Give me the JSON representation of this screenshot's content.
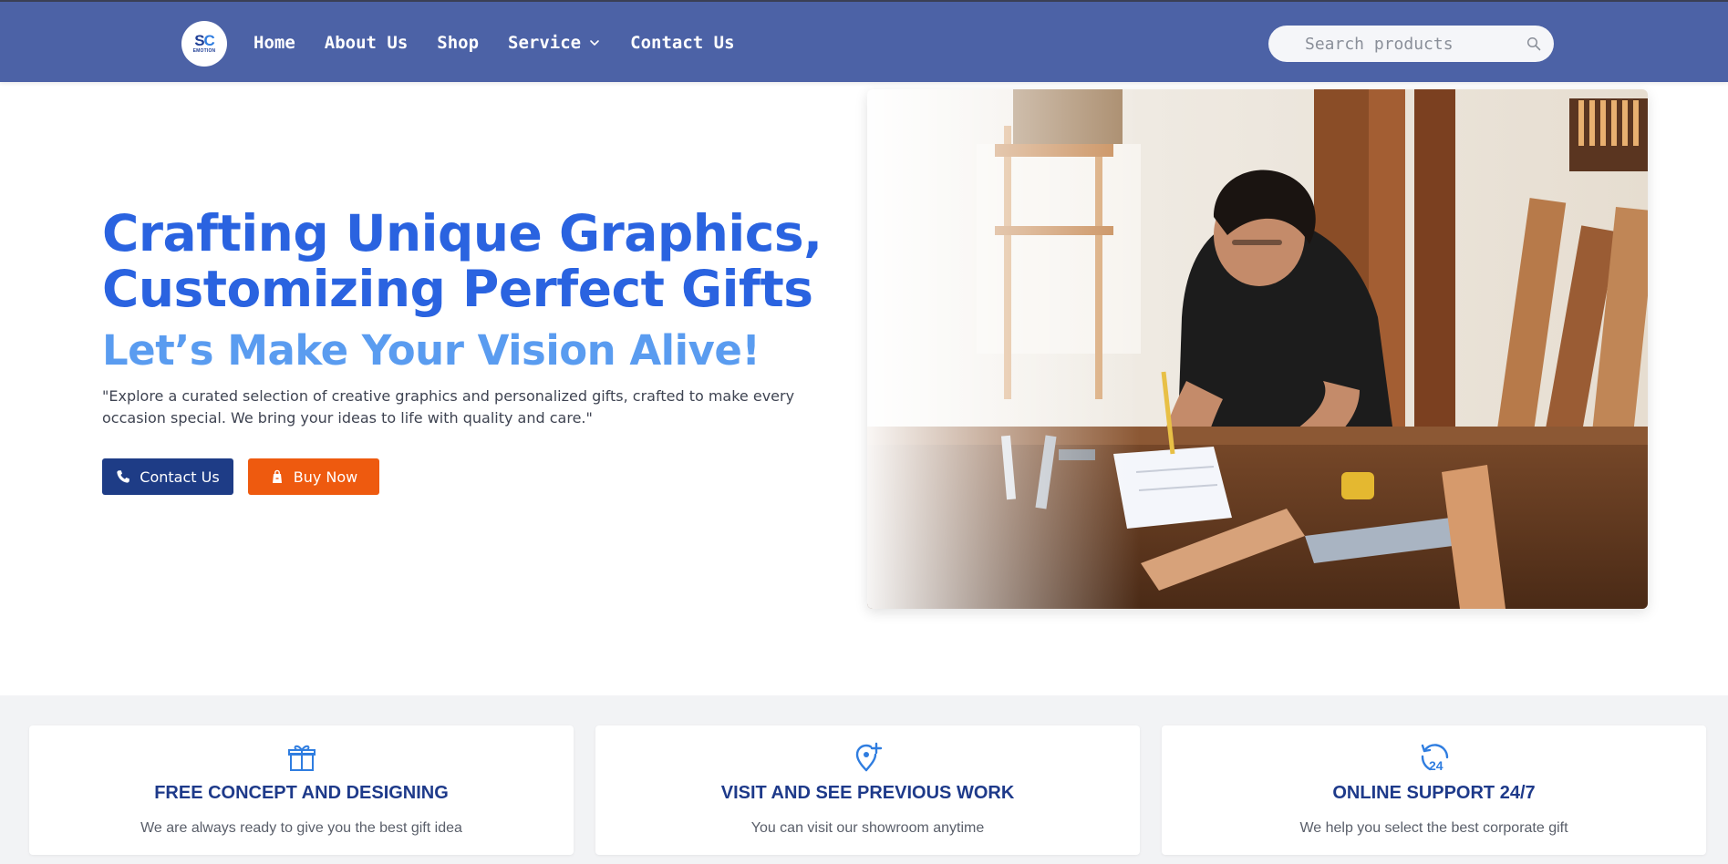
{
  "brand": {
    "logo_mark_s": "S",
    "logo_mark_c": "C",
    "logo_text": "EMOTION",
    "colors": {
      "nav_bg": "#4c62a6",
      "primary_blue": "#2a63e0",
      "light_blue": "#5a9cf0",
      "navy": "#1e3c86",
      "orange": "#ee5a0f"
    }
  },
  "nav": {
    "items": [
      {
        "label": "Home"
      },
      {
        "label": "About Us"
      },
      {
        "label": "Shop"
      },
      {
        "label": "Service",
        "has_dropdown": true,
        "icon": "chevron-down-icon"
      },
      {
        "label": "Contact Us"
      }
    ],
    "search": {
      "placeholder": "Search products",
      "value": "",
      "icon": "search-icon"
    }
  },
  "hero": {
    "title_line1": "Crafting Unique Graphics,",
    "title_line2": "Customizing Perfect Gifts",
    "subtitle": "Let’s Make Your Vision Alive!",
    "description": "\"Explore a curated selection of creative graphics and personalized gifts, crafted to make every occasion special. We bring your ideas to life with quality and care.\"",
    "buttons": {
      "contact": {
        "label": "Contact Us",
        "icon": "phone-icon"
      },
      "buy": {
        "label": "Buy Now",
        "icon": "shopping-bag-icon"
      }
    },
    "image": {
      "alt": "Craftsman sketching on paper at a wooden workbench"
    }
  },
  "features": [
    {
      "icon": "gift-icon",
      "title": "FREE CONCEPT AND DESIGNING",
      "text": "We are always ready to give you the best gift idea"
    },
    {
      "icon": "location-plus-icon",
      "title": "VISIT AND SEE PREVIOUS WORK",
      "text": "You can visit our showroom anytime"
    },
    {
      "icon": "support-24-icon",
      "title": "ONLINE SUPPORT 24/7",
      "text": "We help you select the best corporate gift"
    }
  ]
}
